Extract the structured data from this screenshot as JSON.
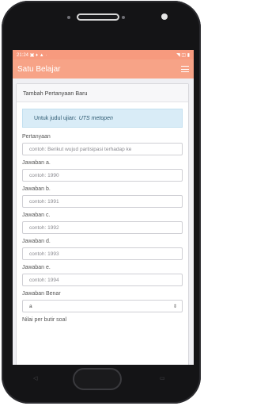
{
  "statusbar": {
    "time": "21:24",
    "left_icons": "▣ ♦ ▲ ·",
    "right_icons": "◥ ◫ ▮"
  },
  "app": {
    "title": "Satu Belajar"
  },
  "form": {
    "header": "Tambah Pertanyaan Baru",
    "info_prefix": "Untuk judul ujian:",
    "info_exam": "UTS metopen",
    "pertanyaan_label": "Pertanyaan",
    "pertanyaan_placeholder": "contoh: Berikut wujud partisipasi terhadap ke",
    "answers": [
      {
        "label": "Jawaban a.",
        "placeholder": "contoh: 1990"
      },
      {
        "label": "Jawaban b.",
        "placeholder": "contoh: 1991"
      },
      {
        "label": "Jawaban c.",
        "placeholder": "contoh: 1992"
      },
      {
        "label": "Jawaban d.",
        "placeholder": "contoh: 1993"
      },
      {
        "label": "Jawaban e.",
        "placeholder": "contoh: 1994"
      }
    ],
    "correct_label": "Jawaban Benar",
    "correct_value": "a",
    "nilai_label": "Nilai per butir soal"
  },
  "colors": {
    "appbar": "#f7a387",
    "statusbar": "#f79a7e",
    "info_bg": "#d9ecf7"
  }
}
